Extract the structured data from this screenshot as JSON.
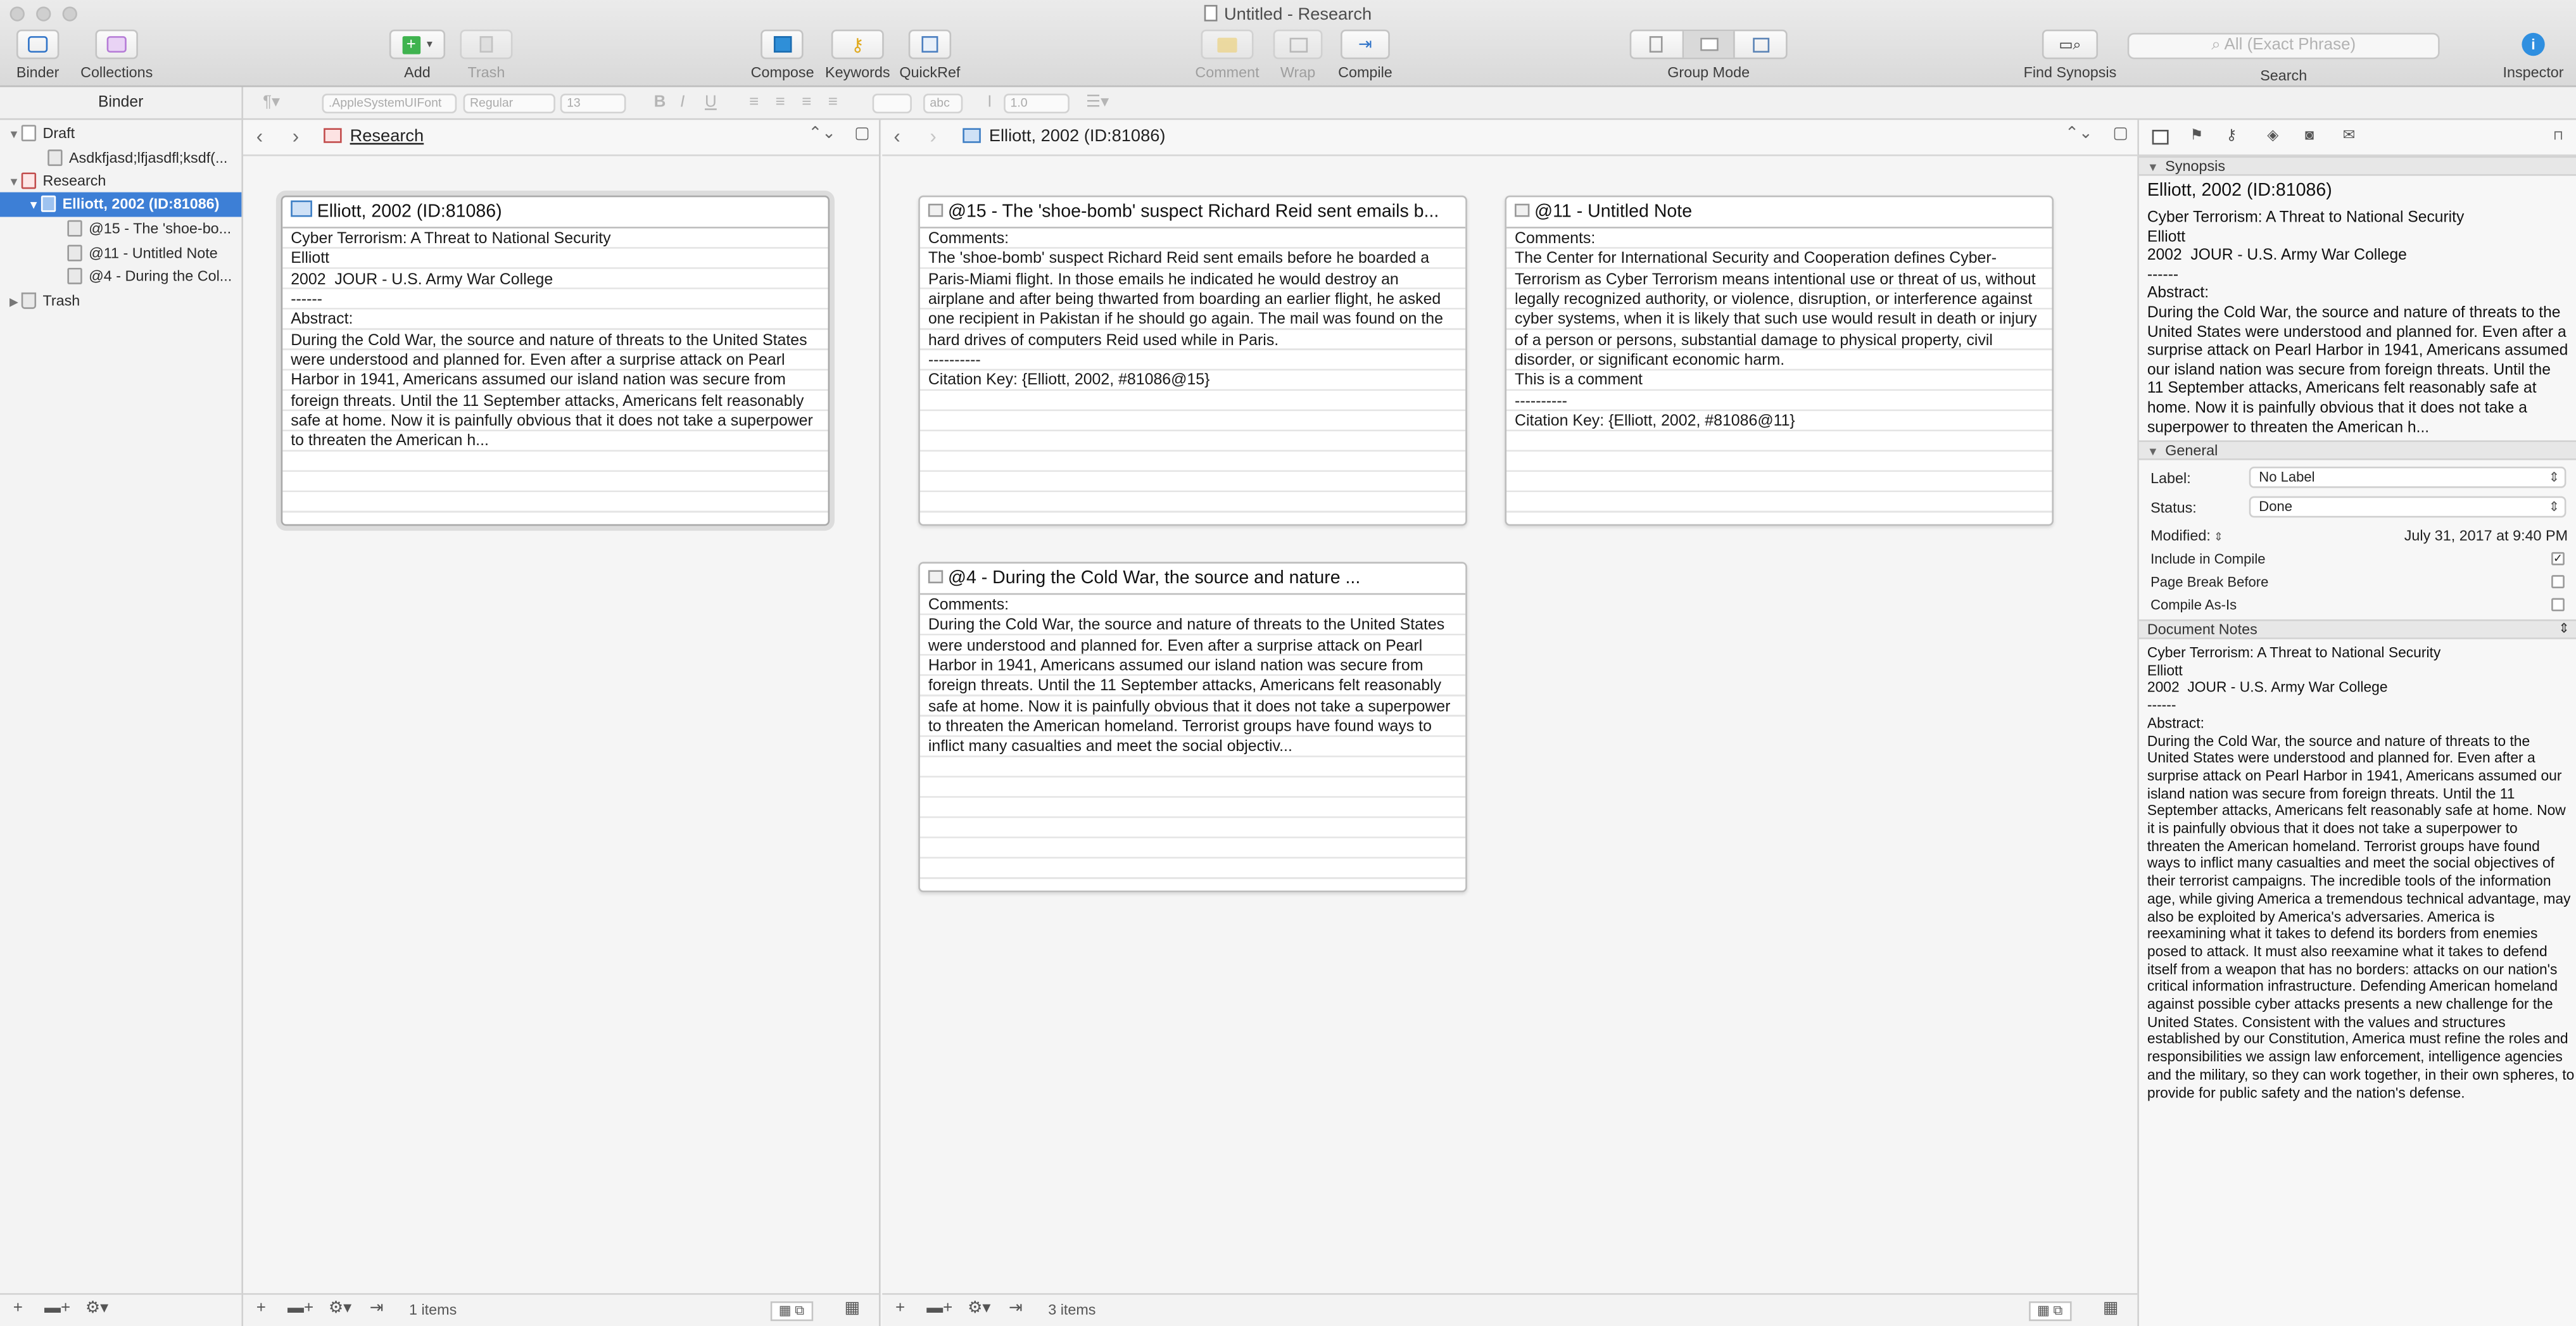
{
  "window": {
    "title": "Untitled - Research"
  },
  "toolbar": {
    "binder": "Binder",
    "collections": "Collections",
    "add": "Add",
    "trash": "Trash",
    "compose": "Compose",
    "keywords": "Keywords",
    "quickref": "QuickRef",
    "comment": "Comment",
    "wrap": "Wrap",
    "compile": "Compile",
    "group_mode": "Group Mode",
    "find_synopsis": "Find Synopsis",
    "search_label": "Search",
    "search_placeholder": "All (Exact Phrase)",
    "inspector": "Inspector"
  },
  "format_bar": {
    "binder_label": "Binder",
    "font": ".AppleSystemUIFont",
    "style": "Regular",
    "size": "13",
    "highlight": "abc",
    "line_spacing": "1.0",
    "bold": "B",
    "italic": "I",
    "underline": "U"
  },
  "binder": {
    "items": [
      {
        "label": "Draft"
      },
      {
        "label": "Asdkfjasd;lfjasdfl;ksdf(..."
      },
      {
        "label": "Research"
      },
      {
        "label": "Elliott, 2002 (ID:81086)"
      },
      {
        "label": "@15 - The 'shoe-bo..."
      },
      {
        "label": "@11 - Untitled Note"
      },
      {
        "label": "@4 - During the Col..."
      },
      {
        "label": "Trash"
      }
    ]
  },
  "left_pane": {
    "breadcrumb": "Research",
    "status": "1 items",
    "cards": [
      {
        "title": "Elliott, 2002 (ID:81086)",
        "body": "Cyber Terrorism: A Threat to National Security\nElliott\n2002  JOUR - U.S. Army War College\n------\nAbstract:\nDuring the Cold War, the source and nature of threats to the United States were understood and planned for. Even after a surprise attack on Pearl Harbor in 1941, Americans assumed our island nation was secure from foreign threats. Until the 11 September attacks, Americans felt reasonably safe at home. Now it is painfully obvious that it does not take a superpower to threaten the American h..."
      }
    ]
  },
  "right_pane": {
    "breadcrumb": "Elliott, 2002 (ID:81086)",
    "status": "3 items",
    "cards": [
      {
        "title": "@15 - The 'shoe-bomb' suspect Richard Reid sent emails b...",
        "body": "Comments:\nThe 'shoe-bomb' suspect Richard Reid sent emails before he boarded a Paris-Miami flight. In those emails he indicated he would destroy an airplane and after being thwarted from boarding an earlier flight, he asked one recipient in Pakistan if he should go again. The mail was found on the hard drives of computers Reid used while in Paris.\n----------\nCitation Key: {Elliott, 2002, #81086@15}"
      },
      {
        "title": "@11 - Untitled Note",
        "body": "Comments:\nThe Center for International Security and Cooperation defines Cyber-Terrorism as Cyber Terrorism means intentional use or threat of us, without legally recognized authority, or violence, disruption, or interference against cyber systems, when it is likely that such use would result in death or injury of a person or persons, substantial damage to physical property, civil disorder, or significant economic harm.\nThis is a comment\n----------\nCitation Key: {Elliott, 2002, #81086@11}"
      },
      {
        "title": "@4 - During the Cold War, the source and nature ...",
        "body": "Comments:\nDuring the Cold War, the source and nature of threats to the United States were understood and planned for. Even after a surprise attack on Pearl Harbor in 1941, Americans assumed our island nation was secure from foreign threats. Until the 11 September attacks, Americans felt reasonably safe at home. Now it is painfully obvious that it does not take a superpower to threaten the American homeland. Terrorist groups have found ways to inflict many casualties and meet the social objectiv..."
      }
    ]
  },
  "inspector": {
    "synopsis_header": "Synopsis",
    "synopsis_title": "Elliott, 2002 (ID:81086)",
    "synopsis_text": "Cyber Terrorism: A Threat to National Security\nElliott\n2002  JOUR - U.S. Army War College\n------\nAbstract:\nDuring the Cold War, the source and nature of threats to the United States were understood and planned for. Even after a surprise attack on Pearl Harbor in 1941, Americans assumed our island nation was secure from foreign threats. Until the 11 September attacks, Americans felt reasonably safe at home. Now it is painfully obvious that it does not take a superpower to threaten the American h...",
    "general_header": "General",
    "label_key": "Label:",
    "label_value": "No Label",
    "status_key": "Status:",
    "status_value": "Done",
    "modified_key": "Modified:",
    "modified_value": "July 31, 2017 at 9:40 PM",
    "include_in_compile": "Include in Compile",
    "include_checked": "✓",
    "page_break_before": "Page Break Before",
    "compile_as_is": "Compile As-Is",
    "notes_header": "Document Notes",
    "notes_text": "Cyber Terrorism: A Threat to National Security\nElliott\n2002  JOUR - U.S. Army War College\n------\nAbstract:\nDuring the Cold War, the source and nature of threats to the United States were understood and planned for. Even after a surprise attack on Pearl Harbor in 1941, Americans assumed our island nation was secure from foreign threats. Until the 11 September attacks, Americans felt reasonably safe at home. Now it is painfully obvious that it does not take a superpower to threaten the American homeland. Terrorist groups have found ways to inflict many casualties and meet the social objectives of their terrorist campaigns. The incredible tools of the information age, while giving America a tremendous technical advantage, may also be exploited by America's adversaries. America is reexamining what it takes to defend its borders from enemies posed to attack. It must also reexamine what it takes to defend itself from a weapon that has no borders: attacks on our nation's critical information infrastructure. Defending American homeland against possible cyber attacks presents a new challenge for the United States. Consistent with the values and structures established by our Constitution, America must refine the roles and responsibilities we assign law enforcement, intelligence agencies and the military, so they can work together, in their own spheres, to provide for public safety and the nation's defense."
  },
  "colors": {
    "accent": "#3d7fd6",
    "add_green": "#3fb34f",
    "keyword_yellow": "#f2c230",
    "collections_purple": "#b57bd6"
  }
}
